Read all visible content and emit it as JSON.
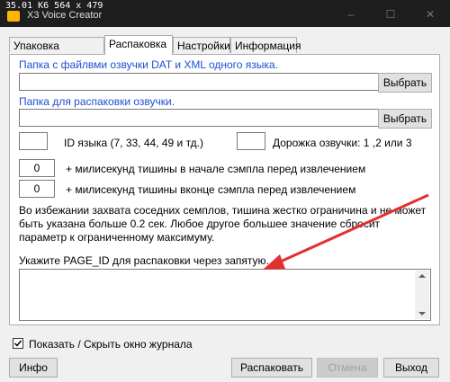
{
  "overlay": "35.01 K6 564 x 479",
  "window": {
    "title": "X3 Voice Creator"
  },
  "tabs": [
    "Упаковка озвучки",
    "Распаковка",
    "Настройки",
    "Информация"
  ],
  "section1": {
    "label": "Папка с файлвми озвучки DAT и XML одного языка.",
    "value": "",
    "browse": "Выбрать"
  },
  "section2": {
    "label": "Папка для распаковки озвучки.",
    "value": "",
    "browse": "Выбрать"
  },
  "lang_id": {
    "value": "",
    "label": "ID языка (7, 33, 44, 49 и тд.)"
  },
  "track": {
    "value": "",
    "label": "Дорожка озвучки: 1 ,2 или 3"
  },
  "silence_start": {
    "value": "0",
    "label": "+ милисекунд тишины в начале сэмпла перед извлечением"
  },
  "silence_end": {
    "value": "0",
    "label": "+ милисекунд тишины вконце сэмпла перед извлечением"
  },
  "note": "Во избежании захвата соседних семплов, тишина жестко ограничина и не может быть указана больше 0.2 сек. Любое другое большее значение сбросит параметр к ограниченному максимуму.",
  "page_id": {
    "label": "Укажите PAGE_ID для распаковки через запятую.",
    "value": ""
  },
  "log_toggle": {
    "label": "Показать / Скрыть окно журнала",
    "checked": true
  },
  "buttons": {
    "info": "Инфо",
    "unpack": "Распаковать",
    "cancel": "Отмена",
    "exit": "Выход"
  },
  "colors": {
    "accent_text": "#1c4fd1",
    "arrow": "#e53030",
    "titlebar": "#1e1e1e"
  }
}
